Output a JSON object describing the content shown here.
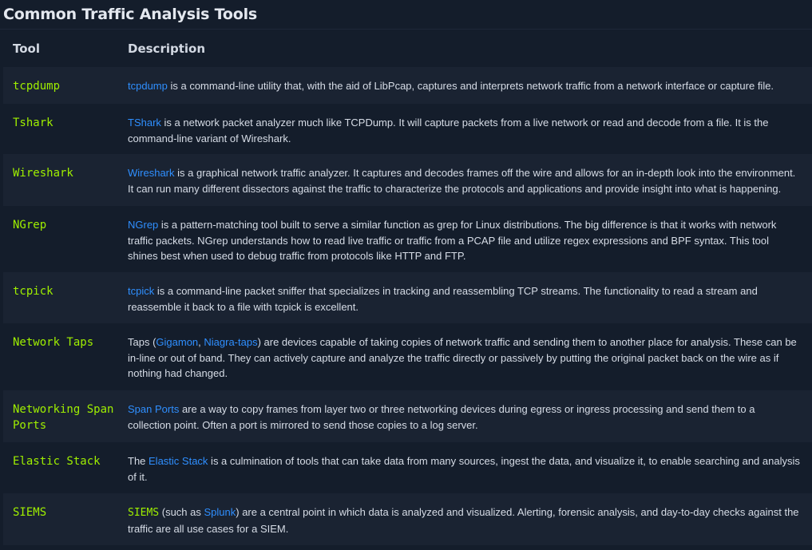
{
  "page": {
    "title": "Common Traffic Analysis Tools"
  },
  "table": {
    "headers": [
      "Tool",
      "Description"
    ],
    "rows": [
      {
        "tool": "tcpdump",
        "parts": [
          {
            "t": "tcpdump",
            "link": true
          },
          {
            "t": " is a command-line utility that, with the aid of LibPcap, captures and interprets network traffic from a network interface or capture file."
          }
        ]
      },
      {
        "tool": "Tshark",
        "parts": [
          {
            "t": "TShark",
            "link": true
          },
          {
            "t": " is a network packet analyzer much like TCPDump. It will capture packets from a live network or read and decode from a file. It is the command-line variant of Wireshark."
          }
        ]
      },
      {
        "tool": "Wireshark",
        "parts": [
          {
            "t": "Wireshark",
            "link": true
          },
          {
            "t": " is a graphical network traffic analyzer. It captures and decodes frames off the wire and allows for an in-depth look into the environment. It can run many different dissectors against the traffic to characterize the protocols and applications and provide insight into what is happening."
          }
        ]
      },
      {
        "tool": "NGrep",
        "parts": [
          {
            "t": "NGrep",
            "link": true
          },
          {
            "t": " is a pattern-matching tool built to serve a similar function as grep for Linux distributions. The big difference is that it works with network traffic packets. NGrep understands how to read live traffic or traffic from a PCAP file and utilize regex expressions and BPF syntax. This tool shines best when used to debug traffic from protocols like HTTP and FTP."
          }
        ]
      },
      {
        "tool": "tcpick",
        "parts": [
          {
            "t": "tcpick",
            "link": true
          },
          {
            "t": " is a command-line packet sniffer that specializes in tracking and reassembling TCP streams. The functionality to read a stream and reassemble it back to a file with tcpick is excellent."
          }
        ]
      },
      {
        "tool": "Network Taps",
        "parts": [
          {
            "t": "Taps ("
          },
          {
            "t": "Gigamon",
            "link": true
          },
          {
            "t": ", "
          },
          {
            "t": "Niagra-taps",
            "link": true
          },
          {
            "t": ") are devices capable of taking copies of network traffic and sending them to another place for analysis. These can be in-line or out of band. They can actively capture and analyze the traffic directly or passively by putting the original packet back on the wire as if nothing had changed."
          }
        ]
      },
      {
        "tool": "Networking Span Ports",
        "parts": [
          {
            "t": "Span Ports",
            "link": true
          },
          {
            "t": " are a way to copy frames from layer two or three networking devices during egress or ingress processing and send them to a collection point. Often a port is mirrored to send those copies to a log server."
          }
        ]
      },
      {
        "tool": "Elastic Stack",
        "parts": [
          {
            "t": "The "
          },
          {
            "t": "Elastic Stack",
            "link": true
          },
          {
            "t": " is a culmination of tools that can take data from many sources, ingest the data, and visualize it, to enable searching and analysis of it."
          }
        ]
      },
      {
        "tool": "SIEMS",
        "parts": [
          {
            "t": "SIEMS",
            "mono": true
          },
          {
            "t": " (such as "
          },
          {
            "t": "Splunk",
            "link": true
          },
          {
            "t": ") are a central point in which data is analyzed and visualized. Alerting, forensic analysis, and day-to-day checks against the traffic are all use cases for a SIEM."
          }
        ]
      }
    ]
  }
}
